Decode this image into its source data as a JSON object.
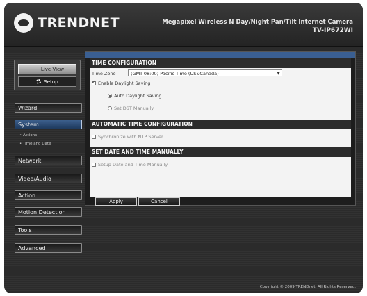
{
  "header": {
    "brand": "TRENDNET",
    "model_line1": "Megapixel Wireless N Day/Night Pan/Tilt Internet Camera",
    "model_line2": "TV-IP672WI"
  },
  "view_buttons": {
    "live_view": "Live View",
    "setup": "Setup"
  },
  "nav": {
    "wizard": "Wizard",
    "system": "System",
    "system_sub": [
      "• Actions",
      "• Time and Date"
    ],
    "network": "Network",
    "video_audio": "Video/Audio",
    "action": "Action",
    "motion_detection": "Motion Detection",
    "tools": "Tools",
    "advanced": "Advanced"
  },
  "time_config": {
    "title": "TIME CONFIGURATION",
    "time_zone_label": "Time Zone",
    "time_zone_value": "(GMT-08:00) Pacific Time (US&Canada)",
    "enable_dst_label": "Enable Daylight Saving",
    "enable_dst_checked": true,
    "auto_dst_label": "Auto Daylight Saving",
    "set_dst_manually_label": "Set DST Manually"
  },
  "auto_time_config": {
    "title": "AUTOMATIC TIME CONFIGURATION",
    "ntp_label": "Synchronize with NTP Server"
  },
  "manual_time": {
    "title": "SET DATE AND TIME MANUALLY",
    "manual_label": "Setup Date and Time Manually"
  },
  "actions": {
    "apply": "Apply",
    "cancel": "Cancel"
  },
  "footer": {
    "copyright": "Copyright © 2009 TRENDnet. All Rights Reserved."
  }
}
